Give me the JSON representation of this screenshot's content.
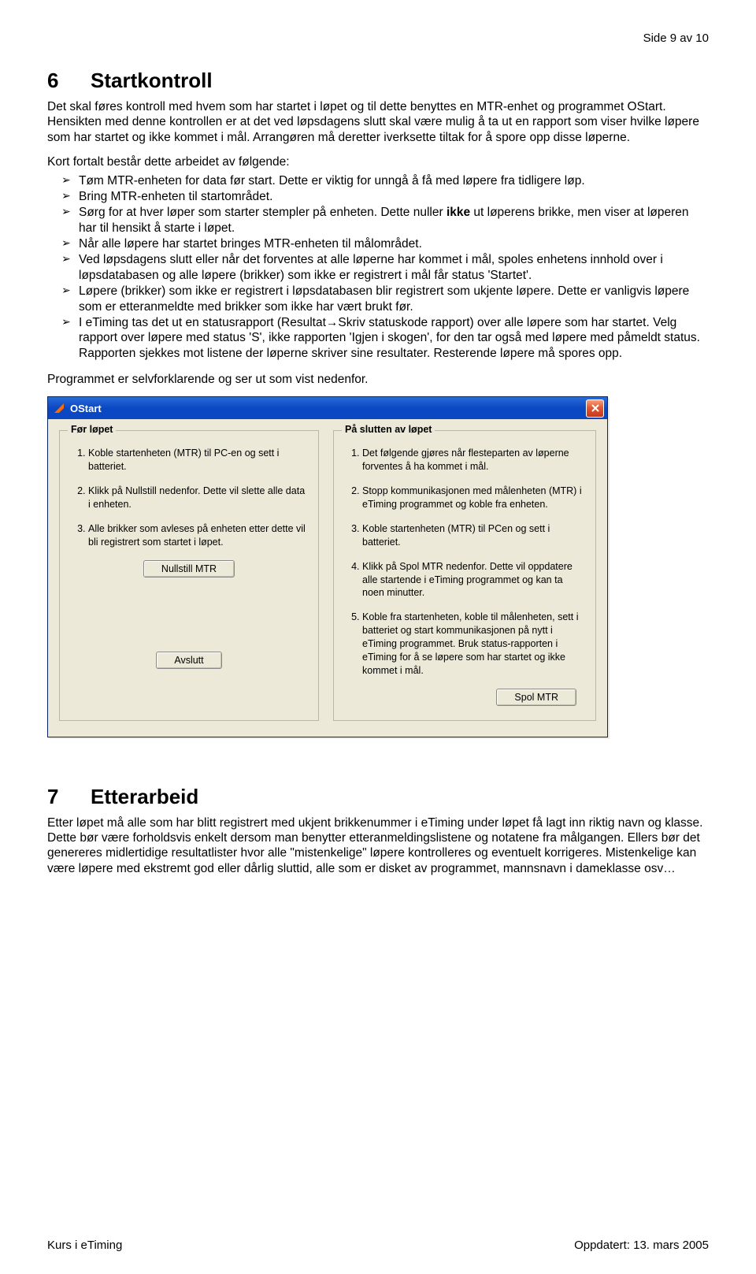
{
  "page": {
    "header_right": "Side 9 av 10",
    "footer_left": "Kurs i eTiming",
    "footer_right": "Oppdatert: 13. mars 2005"
  },
  "section6": {
    "num": "6",
    "title": "Startkontroll",
    "para1": "Det skal føres kontroll med hvem som har startet i løpet og til dette benyttes en MTR-enhet og programmet OStart. Hensikten med denne kontrollen er at det ved løpsdagens slutt skal være mulig å ta ut en rapport som viser hvilke løpere som har startet og ikke kommet i mål. Arrangøren må deretter iverksette tiltak for å spore opp disse løperne.",
    "intro": "Kort fortalt består dette arbeidet av følgende:",
    "bullets": [
      "Tøm MTR-enheten for data før start. Dette er viktig for unngå å få med løpere fra tidligere løp.",
      "Bring MTR-enheten til startområdet.",
      "Sørg for at hver løper som starter stempler på enheten. Dette nuller ikke ut løperens brikke, men viser at løperen har til hensikt å starte i løpet.",
      "Når alle løpere har startet bringes MTR-enheten til målområdet.",
      "Ved løpsdagens slutt eller når det forventes at alle løperne har kommet i mål, spoles enhetens innhold over i løpsdatabasen og alle løpere (brikker) som ikke er registrert i mål får status 'Startet'.",
      "Løpere (brikker) som ikke er registrert i løpsdatabasen blir registrert som ukjente løpere. Dette er vanligvis løpere som er etteranmeldte med brikker som ikke har vært brukt før.",
      "I eTiming tas det ut en statusrapport (Resultat→Skriv statuskode rapport) over alle løpere som har startet. Velg rapport over løpere med status 'S', ikke rapporten 'Igjen i skogen', for den tar også med løpere med påmeldt status. Rapporten sjekkes mot listene der løperne skriver sine resultater. Resterende løpere må spores opp."
    ],
    "closing": "Programmet er selvforklarende og ser ut som vist nedenfor."
  },
  "ostart": {
    "title": "OStart",
    "left": {
      "legend": "Før løpet",
      "items": [
        "Koble startenheten (MTR) til PC-en og sett i batteriet.",
        "Klikk på Nullstill nedenfor. Dette vil slette alle data i enheten.",
        "Alle brikker som avleses på enheten etter dette vil bli registrert som startet i løpet."
      ],
      "button1": "Nullstill MTR",
      "button2": "Avslutt"
    },
    "right": {
      "legend": "På slutten av løpet",
      "items": [
        "Det følgende gjøres når flesteparten av løperne forventes å ha kommet i mål.",
        "Stopp kommunikasjonen med målenheten (MTR) i eTiming programmet og koble fra enheten.",
        "Koble startenheten (MTR) til PCen og sett i batteriet.",
        "Klikk på Spol MTR nedenfor. Dette vil oppdatere alle startende i eTiming programmet og kan ta noen minutter.",
        "Koble fra startenheten, koble til målenheten, sett i batteriet og start kommunikasjonen på nytt i eTiming programmet. Bruk status-rapporten i eTiming for å se løpere som har startet og ikke kommet i mål."
      ],
      "button": "Spol MTR"
    }
  },
  "section7": {
    "num": "7",
    "title": "Etterarbeid",
    "para": "Etter løpet må alle som har blitt registrert med ukjent brikkenummer i eTiming under løpet få lagt inn riktig navn og klasse. Dette bør være forholdsvis enkelt dersom man benytter etteranmeldingslistene og notatene fra målgangen. Ellers bør det genereres midlertidige resultatlister hvor alle \"mistenkelige\" løpere kontrolleres og eventuelt korrigeres. Mistenkelige kan være løpere med ekstremt god eller dårlig sluttid, alle som er disket av programmet, mannsnavn i dameklasse osv…"
  }
}
